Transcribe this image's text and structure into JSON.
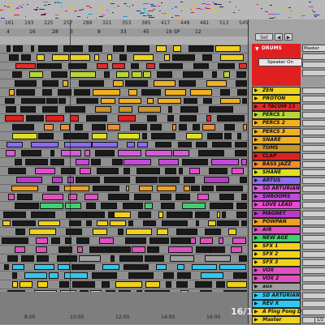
{
  "ruler": {
    "top_labels": [
      "161",
      "193",
      "225",
      "257",
      "289",
      "321",
      "353",
      "385",
      "417",
      "449",
      "481",
      "513",
      "545"
    ],
    "markers": [
      "4",
      "16",
      "28",
      "3",
      "8",
      "33",
      "45",
      "19",
      "SP",
      "12"
    ]
  },
  "top_controls": {
    "set_label": "Set",
    "master_label": "Master"
  },
  "drums": {
    "name": "DRUMS",
    "monitor": "Speaker On",
    "color": "#e02020"
  },
  "tracks": [
    {
      "name": "ZEN",
      "color": "#f0d21b"
    },
    {
      "name": "PROTON",
      "color": "#f0d21b"
    },
    {
      "name": "4 TACOM 13",
      "color": "#e82a2a"
    },
    {
      "name": "PERCS 1",
      "color": "#b8d63a"
    },
    {
      "name": "PERCS 2",
      "color": "#f0b020"
    },
    {
      "name": "PERCS 3",
      "color": "#f0b020"
    },
    {
      "name": "SNARE",
      "color": "#f0b020"
    },
    {
      "name": "TOMS",
      "color": "#c8962a"
    },
    {
      "name": "CLAP",
      "color": "#e02020"
    },
    {
      "name": "BASS JAZZ",
      "color": "#f28c2c"
    },
    {
      "name": "SHANE",
      "color": "#e0e020"
    },
    {
      "name": "ARTUS",
      "color": "#8c6cf0"
    },
    {
      "name": "SD ARTURIAN",
      "color": "#d85ad8"
    },
    {
      "name": "SHROOMS",
      "color": "#c24ad8"
    },
    {
      "name": "LOVE LEAD",
      "color": "#e64ad0"
    },
    {
      "name": "MAGNET",
      "color": "#b83ac8"
    },
    {
      "name": "POWPAN",
      "color": "#f0a020"
    },
    {
      "name": "AIR",
      "color": "#e050c0"
    },
    {
      "name": "NEW AGE",
      "color": "#40d070"
    },
    {
      "name": "SFX 1",
      "color": "#f0d21b"
    },
    {
      "name": "SFX 2",
      "color": "#f0d21b"
    },
    {
      "name": "SFX 3",
      "color": "#f0d21b"
    },
    {
      "name": "VOX",
      "color": "#e050c0"
    },
    {
      "name": "VOX 2",
      "color": "#e050c0"
    },
    {
      "name": "aux",
      "color": "#a0a0a0"
    },
    {
      "name": "SD ARTURIAN",
      "color": "#30c8f0"
    },
    {
      "name": "REV X",
      "color": "#30c8f0"
    },
    {
      "name": "A Ping Pong D",
      "color": "#f0d21b"
    },
    {
      "name": "Master",
      "color": "#f0d21b"
    }
  ],
  "io_small": "1/2",
  "time_ticks": [
    "8:00",
    "10:00",
    "12:00",
    "14:00",
    "16:00"
  ],
  "counter": "16/1"
}
